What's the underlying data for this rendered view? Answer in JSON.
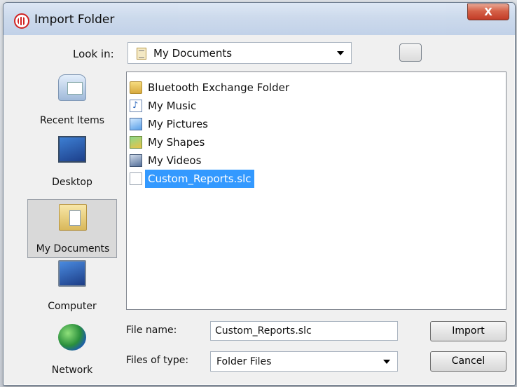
{
  "window": {
    "title": "Import Folder",
    "close_label": "X"
  },
  "look_in": {
    "label": "Look in:",
    "value": "My Documents"
  },
  "places": [
    {
      "label": "Recent Items",
      "icon": "recent-items-icon",
      "selected": false
    },
    {
      "label": "Desktop",
      "icon": "desktop-icon",
      "selected": false
    },
    {
      "label": "My Documents",
      "icon": "my-documents-icon",
      "selected": true
    },
    {
      "label": "Computer",
      "icon": "computer-icon",
      "selected": false
    },
    {
      "label": "Network",
      "icon": "network-icon",
      "selected": false
    }
  ],
  "files": [
    {
      "name": "Bluetooth Exchange Folder",
      "icon": "folder-icon",
      "selected": false
    },
    {
      "name": "My Music",
      "icon": "music-shortcut-icon",
      "selected": false
    },
    {
      "name": "My Pictures",
      "icon": "pictures-shortcut-icon",
      "selected": false
    },
    {
      "name": "My Shapes",
      "icon": "shapes-folder-icon",
      "selected": false
    },
    {
      "name": "My Videos",
      "icon": "videos-shortcut-icon",
      "selected": false
    },
    {
      "name": "Custom_Reports.slc",
      "icon": "file-icon",
      "selected": true
    }
  ],
  "file_name": {
    "label": "File name:",
    "value": "Custom_Reports.slc"
  },
  "file_type": {
    "label": "Files of type:",
    "value": "Folder Files"
  },
  "buttons": {
    "import_label": "Import",
    "cancel_label": "Cancel"
  },
  "colors": {
    "selection": "#3399ff",
    "close_button": "#c0321c"
  }
}
